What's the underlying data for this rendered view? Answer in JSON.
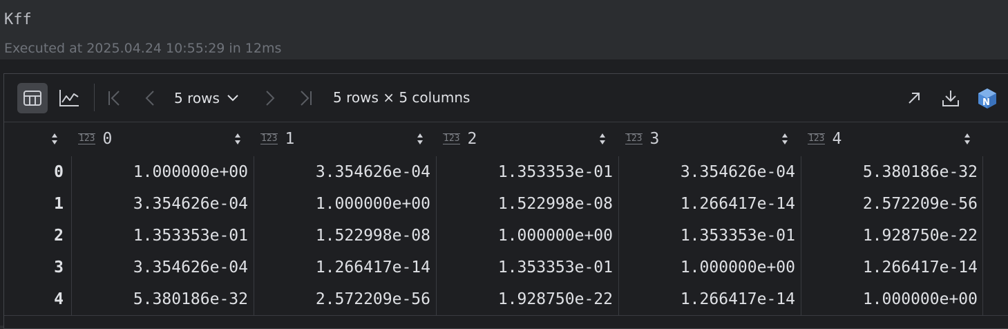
{
  "cell": {
    "title": "Kff",
    "executed": "Executed at 2025.04.24 10:55:29 in 12ms"
  },
  "toolbar": {
    "rows_select": "5 rows",
    "summary": "5 rows × 5 columns",
    "icons": [
      "table-view-icon",
      "chart-view-icon",
      "first-page-icon",
      "prev-page-icon",
      "chevron-down-icon",
      "next-page-icon",
      "last-page-icon",
      "open-in-new-icon",
      "download-icon",
      "numpy-icon"
    ]
  },
  "table": {
    "type_badge": "123",
    "columns": [
      "0",
      "1",
      "2",
      "3",
      "4"
    ],
    "rows": [
      {
        "index": "0",
        "values": [
          "1.000000e+00",
          "3.354626e-04",
          "1.353353e-01",
          "3.354626e-04",
          "5.380186e-32"
        ]
      },
      {
        "index": "1",
        "values": [
          "3.354626e-04",
          "1.000000e+00",
          "1.522998e-08",
          "1.266417e-14",
          "2.572209e-56"
        ]
      },
      {
        "index": "2",
        "values": [
          "1.353353e-01",
          "1.522998e-08",
          "1.000000e+00",
          "1.353353e-01",
          "1.928750e-22"
        ]
      },
      {
        "index": "3",
        "values": [
          "3.354626e-04",
          "1.266417e-14",
          "1.353353e-01",
          "1.000000e+00",
          "1.266417e-14"
        ]
      },
      {
        "index": "4",
        "values": [
          "5.380186e-32",
          "2.572209e-56",
          "1.928750e-22",
          "1.266417e-14",
          "1.000000e+00"
        ]
      }
    ]
  },
  "colors": {
    "background": "#1e1f22",
    "header_bg": "#2b2d30",
    "text": "#dfe1e5",
    "muted": "#6f737a",
    "numpy_accent": "#4d8ad6"
  }
}
